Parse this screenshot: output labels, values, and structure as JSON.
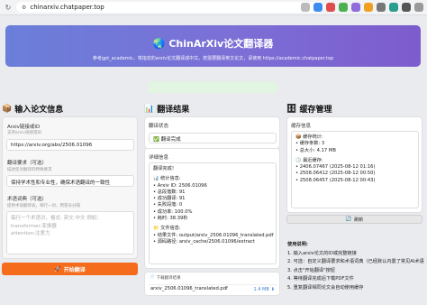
{
  "browser": {
    "url": "chinarxiv.chatpaper.top"
  },
  "hero": {
    "title": "🌏 ChinArXiv论文翻译器",
    "subtitle": "参考gpt_academic，将指定的arxiv论文翻译成中文。若需要翻译英文论文，请使用 https://academic.chatpaper.top"
  },
  "left": {
    "title": "输入论文信息",
    "arxiv_label": "Arxiv链接或ID",
    "arxiv_hint": "支持arxiv链接或ID",
    "arxiv_value": "https://arxiv.org/abs/2506.01096",
    "req_label": "翻译要求（可选）",
    "req_hint": "描述您对翻译的特殊要求",
    "req_value": "保持学术性和专业性，确保术语翻译的一致性",
    "glossary_label": "术语词典（可选）",
    "glossary_hint": "提供术语翻译表，每行一对，用冒号分隔",
    "glossary_placeholder": "每行一个术语对，格式: 英文:中文 例如：\ntransformer:变换器\nattention:注意力",
    "start_button": "开始翻译"
  },
  "middle": {
    "title": "翻译结果",
    "status_label": "翻译状态",
    "status_value": "✅ 翻译完成",
    "detail_label": "详细信息",
    "detail_lines": [
      "翻译完成！",
      "",
      "📊 统计信息:",
      "• Arxiv ID: 2506.01096",
      "• 总段落数: 91",
      "• 成功翻译: 91",
      "• 失败段落: 0",
      "• 成功率: 100.0%",
      "• 耗时: 38.39秒",
      "",
      "📁 文件信息:",
      "• 结果文件: output/arxiv_2506.01096_translated.pdf",
      "• 源码路径: arxiv_cache/2506.01096/extract"
    ],
    "download_label": "下载翻译结果",
    "file_name": "arxiv_2506.01096_translated.pdf",
    "file_size": "1.4 MB"
  },
  "right": {
    "title": "缓存管理",
    "cache_label": "缓存信息",
    "cache_lines": [
      "📦 缓存统计:",
      "• 缓存条数: 3",
      "• 总大小: 4.17 MB",
      "",
      "🕒 最近缓存:",
      "• 2406.07467 (2025-08-12 01:16)",
      "• 2508.06412 (2025-08-12 00:50)",
      "• 2508.06457 (2025-08-12 00:43)"
    ],
    "refresh_button": "刷新",
    "usage_title": "使用说明:",
    "usage_lines": [
      "1. 输入arxiv论文的ID或完整链接",
      "2. 可选：自定义翻译要求和术语词典（已经默认内置了常见AI术语",
      "3. 点击\"开始翻译\"按钮",
      "4. 等待翻译完成后下载PDF文件",
      "5. 重复翻译相同论文会自动使用缓存"
    ]
  }
}
